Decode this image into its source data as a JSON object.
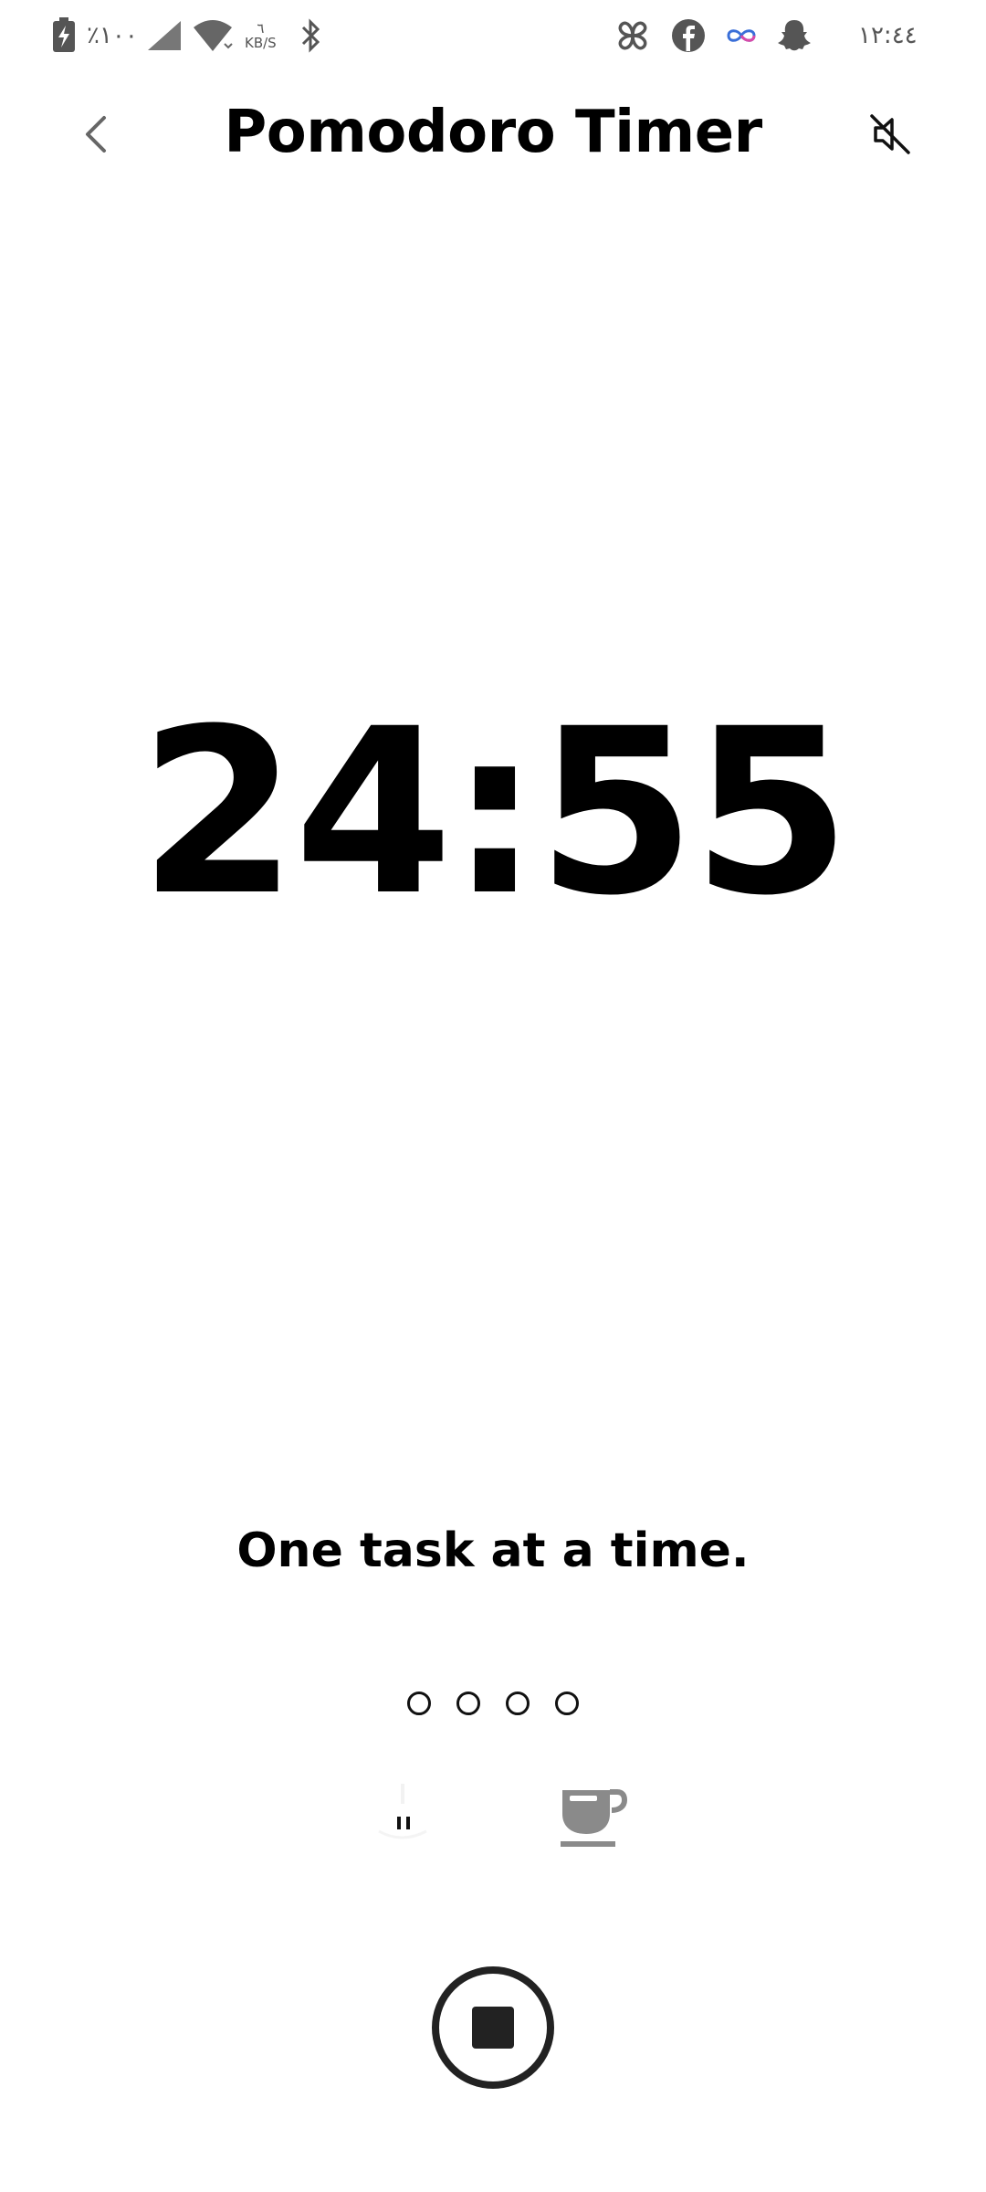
{
  "status_bar": {
    "battery_text": "٪١٠٠",
    "speed_value": "٦",
    "speed_unit": "KB/S",
    "clock": "١٢:٤٤",
    "icons": [
      "battery-charging-icon",
      "signal-icon",
      "wifi-icon",
      "bluetooth-icon",
      "pinwheel-icon",
      "facebook-icon",
      "infinity-icon",
      "snapchat-icon"
    ]
  },
  "app_bar": {
    "title": "Pomodoro Timer",
    "back_icon": "back-arrow-icon",
    "sound_icon": "sound-off-icon"
  },
  "timer": {
    "time": "24:55"
  },
  "motto": "One task at a time.",
  "sessions": {
    "total": 4,
    "completed": 0
  },
  "modes": {
    "work_icon": "work-mode-icon",
    "break_icon": "coffee-cup-icon",
    "active": "work"
  },
  "controls": {
    "stop_icon": "stop-icon"
  },
  "colors": {
    "text": "#000000",
    "icon_gray": "#8a8a8a",
    "button": "#222222"
  }
}
